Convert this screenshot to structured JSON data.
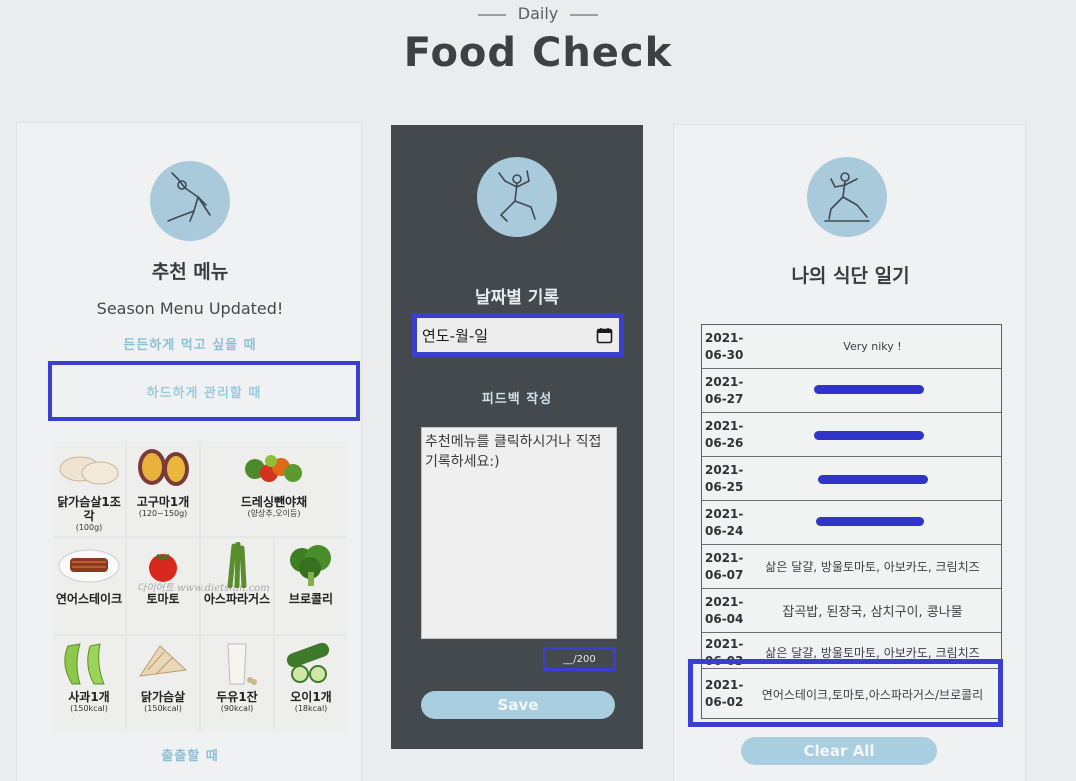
{
  "header": {
    "subtitle": "Daily",
    "title": "Food Check"
  },
  "left": {
    "title": "추천 메뉴",
    "subtitle": "Season Menu Updated!",
    "menus": [
      "든든하게 먹고 싶을 때",
      "하드하게 관리할 때",
      "출출할 때"
    ],
    "foods": [
      {
        "name": "닭가슴살1조각",
        "qty": "(100g)"
      },
      {
        "name": "고구마1개",
        "qty": "(120~150g)"
      },
      {
        "name": "드레싱뺀야채",
        "qty": "(양상추,오이등)"
      },
      {
        "name": "연어스테이크",
        "qty": ""
      },
      {
        "name": "토마토",
        "qty": ""
      },
      {
        "name": "아스파라거스",
        "qty": ""
      },
      {
        "name": "브로콜리",
        "qty": ""
      },
      {
        "name": "사과1개",
        "qty": "(150kcal)"
      },
      {
        "name": "닭가슴살",
        "qty": "(150kcal)"
      },
      {
        "name": "두유1잔",
        "qty": "(90kcal)"
      },
      {
        "name": "오이1개",
        "qty": "(18kcal)"
      }
    ],
    "watermark": "다이어트 www.dietshin.com"
  },
  "middle": {
    "title": "날짜별 기록",
    "date_placeholder": "연도-월-일",
    "feedback_label": "피드백 작성",
    "note_text": "추천메뉴를 클릭하시거나 직접 기록하세요:)",
    "counter": "__/200",
    "save_label": "Save"
  },
  "right": {
    "title": "나의 식단 일기",
    "entries": [
      {
        "date": "2021-06-30",
        "meal": "Very niky !"
      },
      {
        "date": "2021-06-27",
        "meal": ""
      },
      {
        "date": "2021-06-26",
        "meal": ""
      },
      {
        "date": "2021-06-25",
        "meal": ""
      },
      {
        "date": "2021-06-24",
        "meal": ""
      },
      {
        "date": "2021-06-07",
        "meal": "삶은 달걀, 방울토마토, 아보카도, 크림치즈"
      },
      {
        "date": "2021-06-04",
        "meal": "잡곡밥, 된장국, 삼치구이, 콩나물"
      },
      {
        "date": "2021-06-03",
        "meal": "삶은 달걀, 방울토마토, 아보카도, 크림치즈"
      },
      {
        "date": "2021-06-02",
        "meal": "연어스테이크,토마토,아스파라거스/브로콜리"
      }
    ],
    "clear_label": "Clear All"
  },
  "colors": {
    "accent": "#a9cee0",
    "dark_panel": "#44494d",
    "highlight": "#3b3fd0"
  }
}
